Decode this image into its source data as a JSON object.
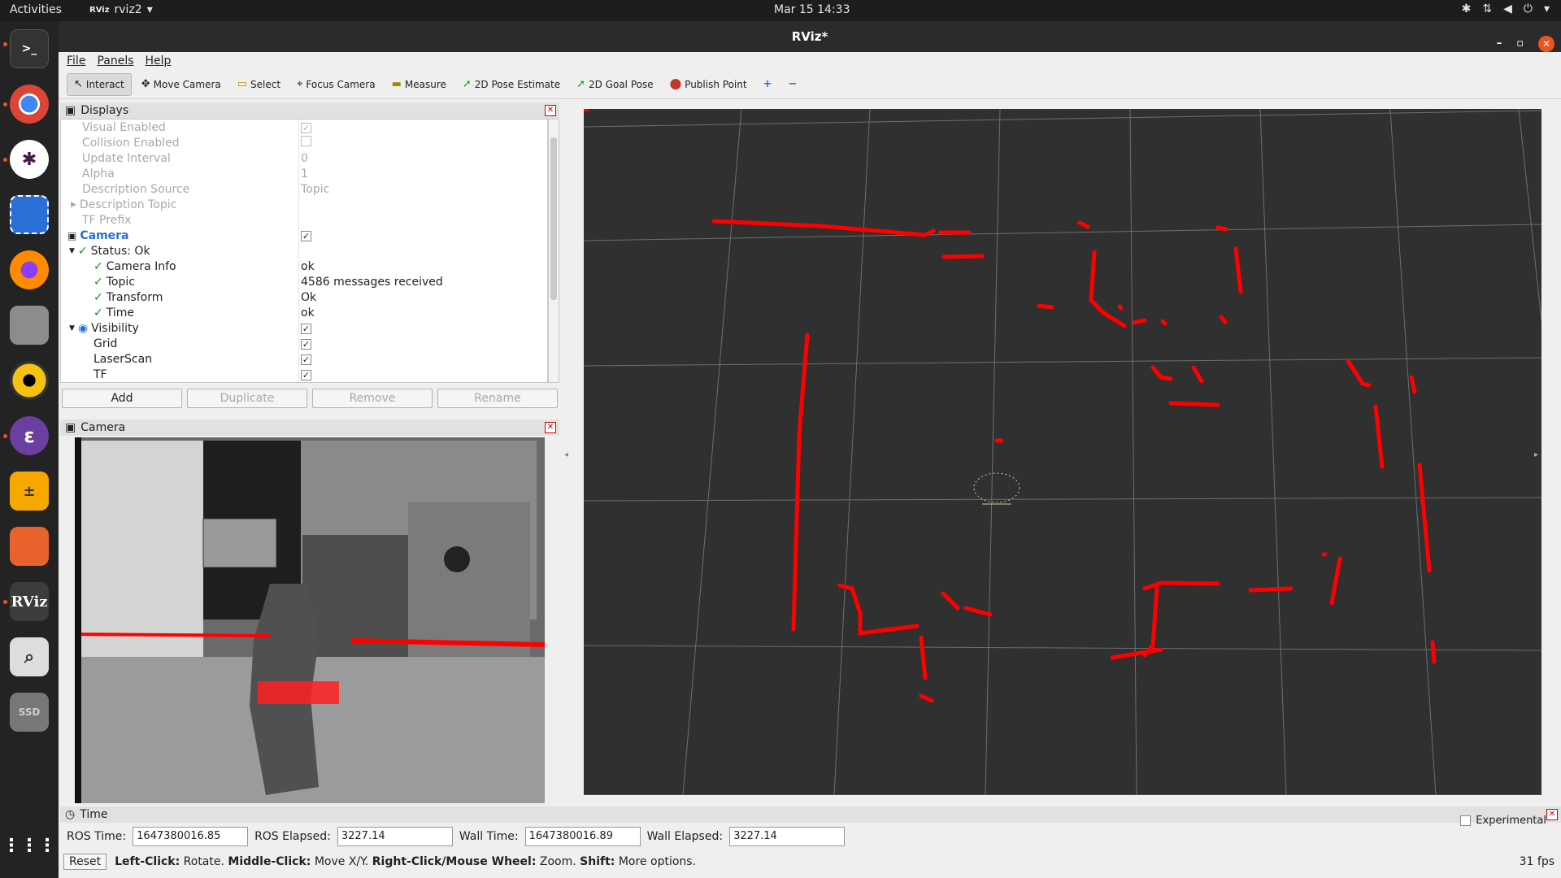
{
  "topbar": {
    "activities": "Activities",
    "app_name": "rviz2",
    "clock": "Mar 15  14:33"
  },
  "window": {
    "title": "RViz*"
  },
  "menu": {
    "items": [
      "File",
      "Panels",
      "Help"
    ]
  },
  "toolbar": {
    "tools": [
      "Interact",
      "Move Camera",
      "Select",
      "Focus Camera",
      "Measure",
      "2D Pose Estimate",
      "2D Goal Pose",
      "Publish Point"
    ]
  },
  "displays_panel": {
    "title": "Displays",
    "rows": [
      {
        "label": "Visual Enabled",
        "checked": true
      },
      {
        "label": "Collision Enabled",
        "checked": false
      },
      {
        "label": "Update Interval",
        "value": "0"
      },
      {
        "label": "Alpha",
        "value": "1"
      },
      {
        "label": "Description Source",
        "value": "Topic"
      },
      {
        "label": "Description Topic",
        "value": ""
      },
      {
        "label": "TF Prefix",
        "value": ""
      },
      {
        "label": "Camera",
        "checked": true
      },
      {
        "label": "Status: Ok"
      },
      {
        "label": "Camera Info",
        "value": "ok"
      },
      {
        "label": "Topic",
        "value": "4586 messages received"
      },
      {
        "label": "Transform",
        "value": "Ok"
      },
      {
        "label": "Time",
        "value": "ok"
      },
      {
        "label": "Visibility",
        "checked": true
      },
      {
        "label": "Grid",
        "checked": true
      },
      {
        "label": "LaserScan",
        "checked": true
      },
      {
        "label": "TF",
        "checked": true
      }
    ],
    "buttons": [
      "Add",
      "Duplicate",
      "Remove",
      "Rename"
    ]
  },
  "camera_panel": {
    "title": "Camera"
  },
  "time_panel": {
    "title": "Time",
    "ros_time_label": "ROS Time:",
    "ros_time": "1647380016.85",
    "ros_elapsed_label": "ROS Elapsed:",
    "ros_elapsed": "3227.14",
    "wall_time_label": "Wall Time:",
    "wall_time": "1647380016.89",
    "wall_elapsed_label": "Wall Elapsed:",
    "wall_elapsed": "3227.14",
    "experimental": "Experimental"
  },
  "status": {
    "reset": "Reset",
    "left_click": "Left-Click:",
    "left_click_desc": "Rotate.",
    "middle_click": "Middle-Click:",
    "middle_click_desc": "Move X/Y.",
    "right_click": "Right-Click/Mouse Wheel:",
    "right_click_desc": "Zoom.",
    "shift": "Shift:",
    "shift_desc": "More options.",
    "fps": "31 fps"
  },
  "colors": {
    "laser": "#ff0000",
    "accent": "#e95420"
  }
}
